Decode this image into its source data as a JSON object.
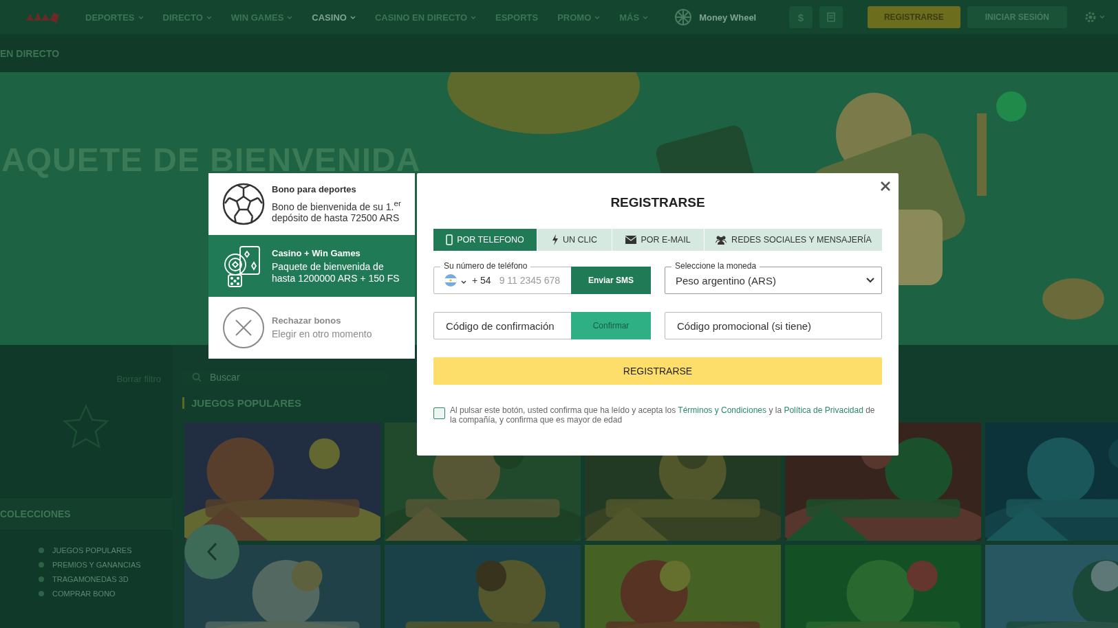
{
  "header": {
    "nav": [
      {
        "label": "DEPORTES",
        "selected": false,
        "dropdown": true
      },
      {
        "label": "DIRECTO",
        "selected": false,
        "dropdown": true
      },
      {
        "label": "WIN GAMES",
        "selected": false,
        "dropdown": true
      },
      {
        "label": "CASINO",
        "selected": true,
        "dropdown": true
      },
      {
        "label": "CASINO EN DIRECTO",
        "selected": false,
        "dropdown": true
      },
      {
        "label": "ESPORTS",
        "selected": false,
        "dropdown": false
      },
      {
        "label": "PROMO",
        "selected": false,
        "dropdown": true
      },
      {
        "label": "MÁS",
        "selected": false,
        "dropdown": true
      }
    ],
    "wheel_label": "Money Wheel",
    "currency_symbol": "$",
    "register": "REGISTRARSE",
    "login": "INICIAR SESIÓN"
  },
  "subheader": {
    "label": "EN DIRECTO"
  },
  "banner": {
    "title": "AQUETE DE BIENVENIDA"
  },
  "sidebar": {
    "clear_filter": "Borrar filtro",
    "section": "COLECCIONES",
    "items": [
      "JUEGOS POPULARES",
      "PREMIOS Y GANANCIAS",
      "TRAGAMONEDAS 3D",
      "COMPRAR BONO"
    ]
  },
  "main": {
    "search": {
      "placeholder": "Buscar"
    },
    "section_title": "JUEGOS POPULARES"
  },
  "bonuses": [
    {
      "kind": "sports",
      "title": "Bono para deportes",
      "description": "Bono de bienvenida de su 1.$^{er}$ depósito de hasta 72500 ARS",
      "selected": false
    },
    {
      "kind": "casino",
      "title": "Casino + Win Games",
      "description": "Paquete de bienvenida de hasta 1200000 ARS + 150 FS",
      "selected": true
    },
    {
      "kind": "decline",
      "title": "Rechazar bonos",
      "description": "Elegir en otro momento",
      "selected": false
    }
  ],
  "dialog": {
    "title": "REGISTRARSE",
    "tabs": [
      {
        "kind": "phone",
        "label": "POR TELEFONO",
        "selected": true
      },
      {
        "kind": "bolt",
        "label": "UN CLIC",
        "selected": false
      },
      {
        "kind": "mail",
        "label": "POR E-MAIL",
        "selected": false
      },
      {
        "kind": "people",
        "label": "REDES SOCIALES Y MENSAJERÍA",
        "selected": false
      }
    ],
    "phone": {
      "label": "Su número de teléfono",
      "prefix": "+ 54",
      "placeholder": "9 11 2345 678",
      "button": "Enviar SMS"
    },
    "currency": {
      "label": "Seleccione la moneda",
      "value": "Peso argentino (ARS)"
    },
    "code": {
      "placeholder": "Código de confirmación",
      "button": "Confirmar",
      "disabled": true
    },
    "promo": {
      "placeholder": "Código promocional (si tiene)"
    },
    "submit": "REGISTRARSE",
    "consent": {
      "checked": false,
      "text_before": "Al pulsar este botón, usted confirma que ha leído y acepta los",
      "terms_link": "Términos y Condiciones",
      "text_middle": "y la",
      "privacy_link": "Política de Privacidad",
      "text_after": "de la compañía, y confirma que es mayor de edad"
    }
  }
}
